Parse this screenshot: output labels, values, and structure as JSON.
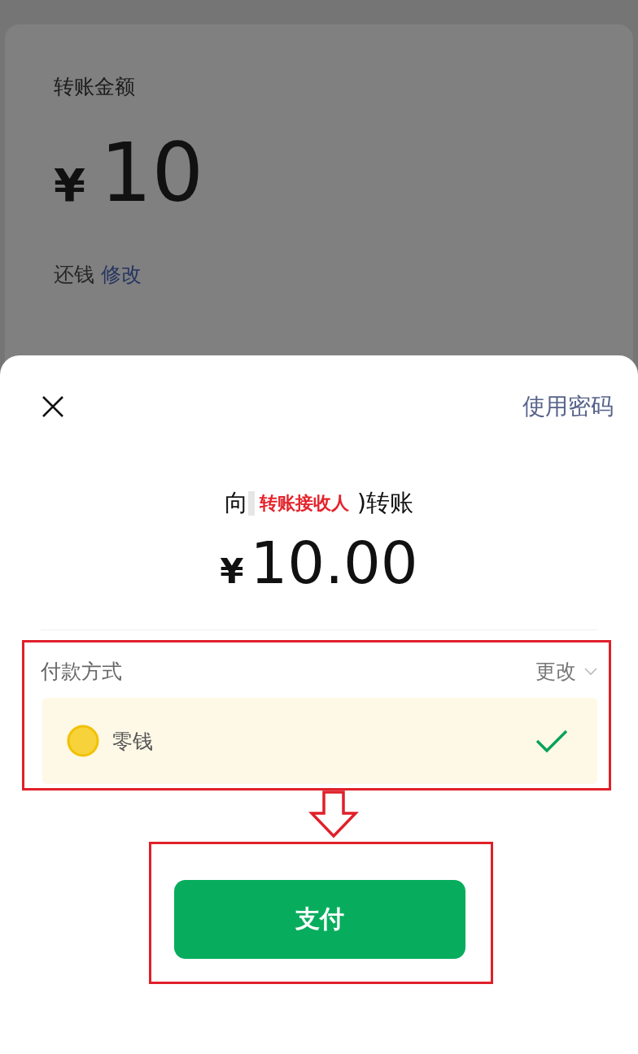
{
  "background": {
    "title": "转账金额",
    "currency": "¥",
    "amount": "10",
    "note": "还钱",
    "edit_link": "修改"
  },
  "sheet": {
    "use_password": "使用密码",
    "recipient": {
      "prefix": "向",
      "name": "转账接收人",
      "suffix": ")转账"
    },
    "currency": "¥",
    "amount": "10.00",
    "payment": {
      "title": "付款方式",
      "change": "更改",
      "methods": [
        {
          "label": "零钱",
          "selected": true
        }
      ]
    },
    "pay_button": "支付"
  },
  "annotations": [
    {
      "kind": "payment_frame"
    },
    {
      "kind": "arrow"
    },
    {
      "kind": "button_frame"
    }
  ]
}
